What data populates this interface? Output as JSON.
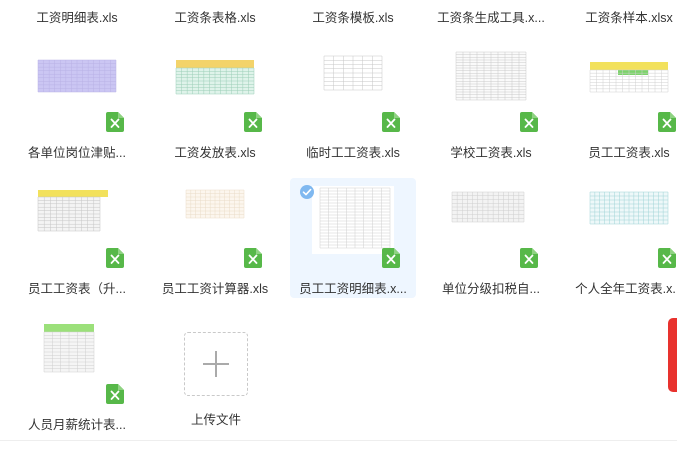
{
  "top_row_labels": [
    "工资明细表.xls",
    "工资条表格.xls",
    "工资条模板.xls",
    "工资条生成工具.x...",
    "工资条样本.xlsx"
  ],
  "files": [
    {
      "name": "各单位岗位津贴...",
      "thumb": "purple-grid"
    },
    {
      "name": "工资发放表.xls",
      "thumb": "yellow-green-grid"
    },
    {
      "name": "临时工工资表.xls",
      "thumb": "sparse-grid"
    },
    {
      "name": "学校工资表.xls",
      "thumb": "dense-grid"
    },
    {
      "name": "员工工资表.xls",
      "thumb": "yellow-header-grid"
    },
    {
      "name": "员工工资表（升...",
      "thumb": "yellow-header-grid-2"
    },
    {
      "name": "员工工资计算器.xls",
      "thumb": "faint-grid"
    },
    {
      "name": "员工工资明细表.x...",
      "thumb": "sheet-grid",
      "selected": true
    },
    {
      "name": "单位分级扣税自...",
      "thumb": "grey-grid"
    },
    {
      "name": "个人全年工资表.x...",
      "thumb": "teal-grid"
    },
    {
      "name": "人员月薪统计表...",
      "thumb": "green-header-grid"
    }
  ],
  "upload": {
    "label": "上传文件"
  },
  "colors": {
    "xls_green": "#57b849",
    "selected_bg": "#eef6ff",
    "accent": "#7fb8f0",
    "side_tab": "#e8322e"
  }
}
